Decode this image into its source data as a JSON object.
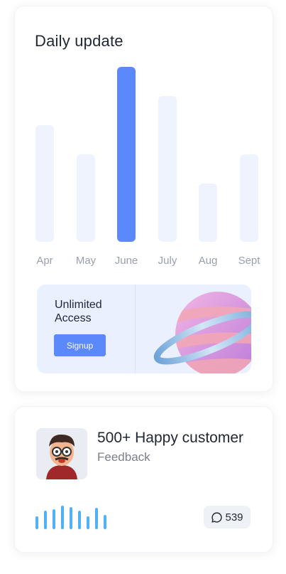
{
  "daily_update": {
    "title": "Daily update",
    "chart_data": {
      "type": "bar",
      "categories": [
        "Apr",
        "May",
        "June",
        "July",
        "Aug",
        "Sept"
      ],
      "values": [
        60,
        45,
        90,
        75,
        30,
        45
      ],
      "highlighted": "June",
      "ylim": [
        0,
        90
      ],
      "bar_color": "#eef3fd",
      "highlight_color": "#5b88fa"
    }
  },
  "promo": {
    "title": "Unlimited Access",
    "button_label": "Signup",
    "illustration": "planet-icon"
  },
  "customer": {
    "title": "500+ Happy customer",
    "subtitle": "Feedback",
    "comment_icon": "comment-icon",
    "comment_count": "539",
    "wave_color": "#4fb2f5"
  }
}
